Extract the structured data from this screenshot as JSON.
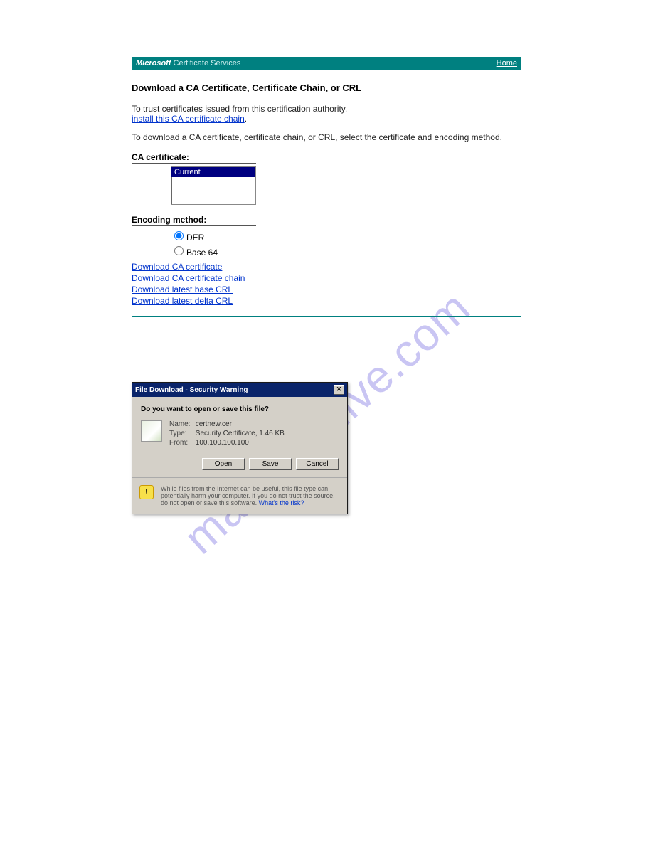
{
  "header": {
    "brand": "Microsoft",
    "brand_secondary": " Certificate Services",
    "home_link": "Home"
  },
  "page_title": "Download a CA Certificate, Certificate Chain, or CRL",
  "intro": {
    "line1": "To trust certificates issued from this certification authority,",
    "install_link": "install this CA certificate chain",
    "period": "."
  },
  "instructions": "To download a CA certificate, certificate chain, or CRL, select the certificate and encoding method.",
  "ca_cert": {
    "label": "CA certificate:",
    "selected_item": "Current"
  },
  "encoding": {
    "label": "Encoding method:",
    "options": {
      "der": "DER",
      "base64": "Base 64"
    }
  },
  "downloads": {
    "ca_cert": "Download CA certificate",
    "ca_chain": "Download CA certificate chain",
    "base_crl": "Download latest base CRL",
    "delta_crl": "Download latest delta CRL"
  },
  "dialog": {
    "title": "File Download - Security Warning",
    "question": "Do you want to open or save this file?",
    "name_label": "Name:",
    "name_value": "certnew.cer",
    "type_label": "Type:",
    "type_value": "Security Certificate, 1.46 KB",
    "from_label": "From:",
    "from_value": "100.100.100.100",
    "buttons": {
      "open": "Open",
      "save": "Save",
      "cancel": "Cancel"
    },
    "warning_text": "While files from the Internet can be useful, this file type can potentially harm your computer. If you do not trust the source, do not open or save this software. ",
    "risk_link": "What's the risk?"
  },
  "watermark": "manualshive.com"
}
